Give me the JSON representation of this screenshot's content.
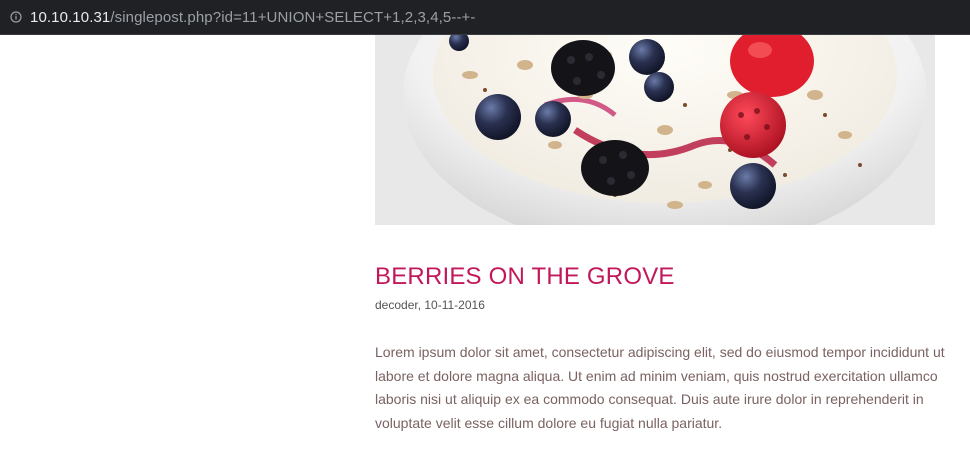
{
  "browser": {
    "url_host": "10.10.10.31",
    "url_path": "/singlepost.php?id=11+UNION+SELECT+1,2,3,4,5--+-",
    "icon": "info-icon"
  },
  "post": {
    "title": "BERRIES ON THE GROVE",
    "meta": "decoder, 10-11-2016",
    "body": "Lorem ipsum dolor sit amet, consectetur adipiscing elit, sed do eiusmod tempor incididunt ut labore et dolore magna aliqua. Ut enim ad minim veniam, quis nostrud exercitation ullamco laboris nisi ut aliquip ex ea commodo consequat. Duis aute irure dolor in reprehenderit in voluptate velit esse cillum dolore eu fugiat nulla pariatur."
  },
  "colors": {
    "title": "#c2185b",
    "body_text": "#7a6262",
    "toolbar": "#202124"
  }
}
